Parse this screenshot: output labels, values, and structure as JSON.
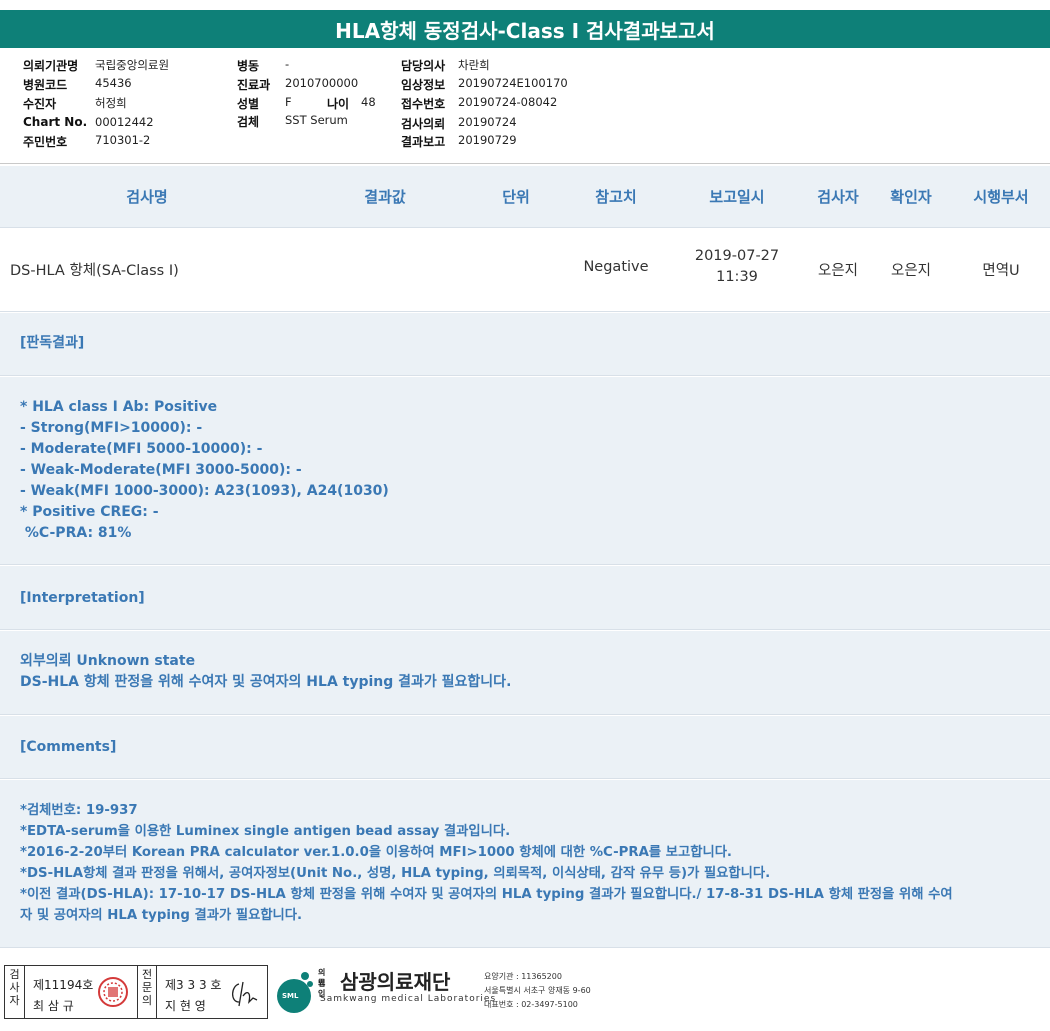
{
  "title": "HLA항체 동정검사-Class I 검사결과보고서",
  "info": {
    "col1": [
      {
        "label": "의뢰기관명",
        "value": "국립중앙의료원"
      },
      {
        "label": "병원코드",
        "value": "45436"
      },
      {
        "label": "수진자",
        "value": "허정희"
      },
      {
        "label": "Chart No.",
        "value": "00012442"
      },
      {
        "label": "주민번호",
        "value": "710301-2"
      }
    ],
    "col2": [
      {
        "label": "병동",
        "value": "-"
      },
      {
        "label": "진료과",
        "value": "2010700000"
      },
      {
        "label": "성별",
        "value": "F"
      },
      {
        "label": "검체",
        "value": "SST Serum"
      }
    ],
    "age_label": "나이",
    "age_value": "48",
    "col3": [
      {
        "label": "담당의사",
        "value": "차란희"
      },
      {
        "label": "임상정보",
        "value": "20190724E100170"
      },
      {
        "label": "접수번호",
        "value": "20190724-08042"
      },
      {
        "label": "검사의뢰",
        "value": "20190724"
      },
      {
        "label": "결과보고",
        "value": "20190729"
      }
    ]
  },
  "table": {
    "headers": [
      "검사명",
      "결과값",
      "단위",
      "참고치",
      "보고일시",
      "검사자",
      "확인자",
      "시행부서"
    ],
    "row": {
      "test_name": "DS-HLA 항체(SA-Class I)",
      "result": "",
      "unit": "",
      "reference": "Negative",
      "report_date": "2019-07-27",
      "report_time": "11:39",
      "tester": "오은지",
      "confirmer": "오은지",
      "department": "면역U"
    }
  },
  "sections": {
    "judgement_title": "[판독결과]",
    "judgement_lines": [
      "* HLA class I Ab: Positive",
      "- Strong(MFI>10000): -",
      "- Moderate(MFI 5000-10000): -",
      "- Weak-Moderate(MFI 3000-5000): -",
      "- Weak(MFI 1000-3000): A23(1093), A24(1030)",
      "* Positive CREG: -",
      " %C-PRA: 81%"
    ],
    "interpretation_title": "[Interpretation]",
    "interpretation_lines": [
      "외부의뢰 Unknown state",
      "DS-HLA 항체 판정을 위해 수여자 및 공여자의 HLA typing 결과가 필요합니다."
    ],
    "comments_title": "[Comments]",
    "comments_lines": [
      "*검체번호: 19-937",
      "*EDTA-serum을 이용한 Luminex single antigen bead assay 결과입니다.",
      "*2016-2-20부터 Korean PRA calculator ver.1.0.0을 이용하여 MFI>1000 항체에 대한 %C-PRA를 보고합니다.",
      "*DS-HLA항체 결과 판정을 위해서, 공여자정보(Unit No., 성명, HLA typing, 의뢰목적, 이식상태, 감작 유무 등)가 필요합니다.",
      "*이전 결과(DS-HLA): 17-10-17 DS-HLA 항체 판정을 위해 수여자 및 공여자의 HLA typing 결과가 필요합니다./ 17-8-31 DS-HLA 항체 판정을 위해 수여",
      "자 및 공여자의 HLA typing 결과가 필요합니다."
    ]
  },
  "footer": {
    "tester_label": "검사자",
    "tester_no": "제11194호",
    "tester_name": "최 삼 규",
    "specialist_label": "전문의",
    "specialist_no": "제3 3 3 호",
    "specialist_name": "지 현 영",
    "logo_badge": "SML",
    "logo_prefix_1": "의료",
    "logo_prefix_2": "법인",
    "logo_name": "삼광의료재단",
    "logo_english": "Samkwang medical Laboratories",
    "org_code": "요양기관 : 11365200",
    "address": "서울특별시 서초구 양재동 9-60",
    "phone": "대표번호 : 02-3497-5100",
    "brand_color": "#0e8078",
    "accent_color": "#3a78b4",
    "seal_color": "#d43a3a"
  }
}
